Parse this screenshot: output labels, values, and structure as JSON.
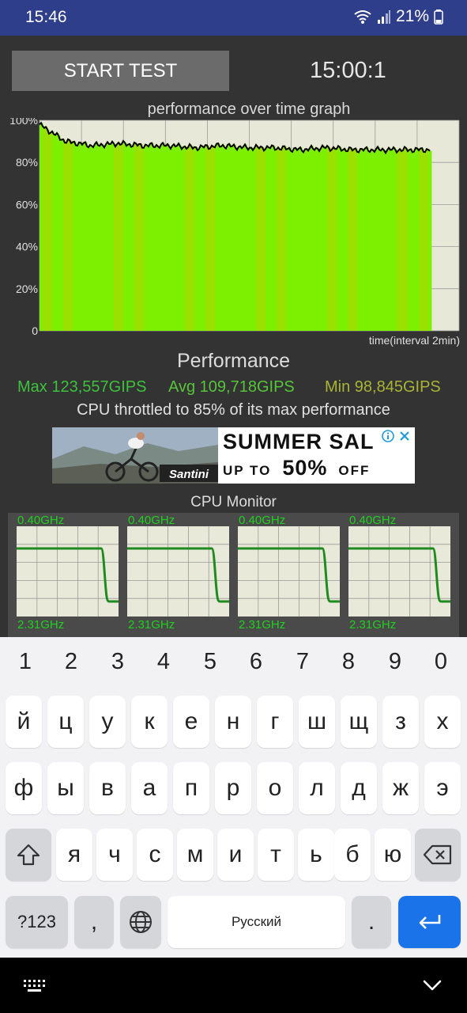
{
  "status_bar": {
    "time": "15:46",
    "battery": "21%"
  },
  "app": {
    "start_button": "START TEST",
    "timer": "15:00:1",
    "graph": {
      "title": "performance over time graph",
      "y_ticks": [
        "100%",
        "80%",
        "60%",
        "40%",
        "20%",
        "0"
      ],
      "x_label": "time(interval 2min)"
    },
    "performance_title": "Performance",
    "stats": {
      "max": "Max 123,557GIPS",
      "avg": "Avg 109,718GIPS",
      "min": "Min 98,845GIPS"
    },
    "throttle_text": "CPU throttled to 85% of its max performance",
    "ad": {
      "brand": "Santini",
      "headline": "SUMMER SAL",
      "sub_left": "UP TO",
      "sub_big": "50%",
      "sub_right": "OFF"
    },
    "cpu_monitor": {
      "title": "CPU Monitor",
      "cores": [
        {
          "top_freq": "0.40GHz",
          "bottom_freq": "2.31GHz"
        },
        {
          "top_freq": "0.40GHz",
          "bottom_freq": "2.31GHz"
        },
        {
          "top_freq": "0.40GHz",
          "bottom_freq": "2.31GHz"
        },
        {
          "top_freq": "0.40GHz",
          "bottom_freq": "2.31GHz"
        }
      ]
    }
  },
  "chart_data": {
    "type": "line",
    "title": "performance over time graph",
    "xlabel": "time(interval 2min)",
    "ylabel": "",
    "ylim": [
      0,
      100
    ],
    "y_unit": "%",
    "grid": true,
    "x": [
      0,
      1,
      2,
      3,
      4,
      5,
      6,
      7,
      8,
      9,
      10,
      11,
      12,
      13,
      14,
      15
    ],
    "series": [
      {
        "values": [
          98,
          90,
          88,
          89,
          88,
          88,
          87,
          88,
          87,
          87,
          86,
          87,
          86,
          86,
          86,
          86
        ]
      }
    ],
    "colors": {
      "fill_primary": "#7cf000",
      "fill_secondary": "#9ae000",
      "line": "#000000",
      "plot_bg": "#e8e8d8"
    }
  },
  "keyboard": {
    "number_row": [
      "1",
      "2",
      "3",
      "4",
      "5",
      "6",
      "7",
      "8",
      "9",
      "0"
    ],
    "row1": [
      "й",
      "ц",
      "у",
      "к",
      "е",
      "н",
      "г",
      "ш",
      "щ",
      "з",
      "х"
    ],
    "row2": [
      "ф",
      "ы",
      "в",
      "а",
      "п",
      "р",
      "о",
      "л",
      "д",
      "ж",
      "э"
    ],
    "row3": [
      "я",
      "ч",
      "с",
      "м",
      "и",
      "т",
      "ь",
      "б",
      "ю"
    ],
    "symbols_key": "?123",
    "comma_key": ",",
    "space_label": "Русский",
    "period_key": ".",
    "shift_icon": "shift-icon",
    "backspace_icon": "backspace-icon",
    "globe_icon": "globe-icon",
    "enter_icon": "enter-icon"
  }
}
